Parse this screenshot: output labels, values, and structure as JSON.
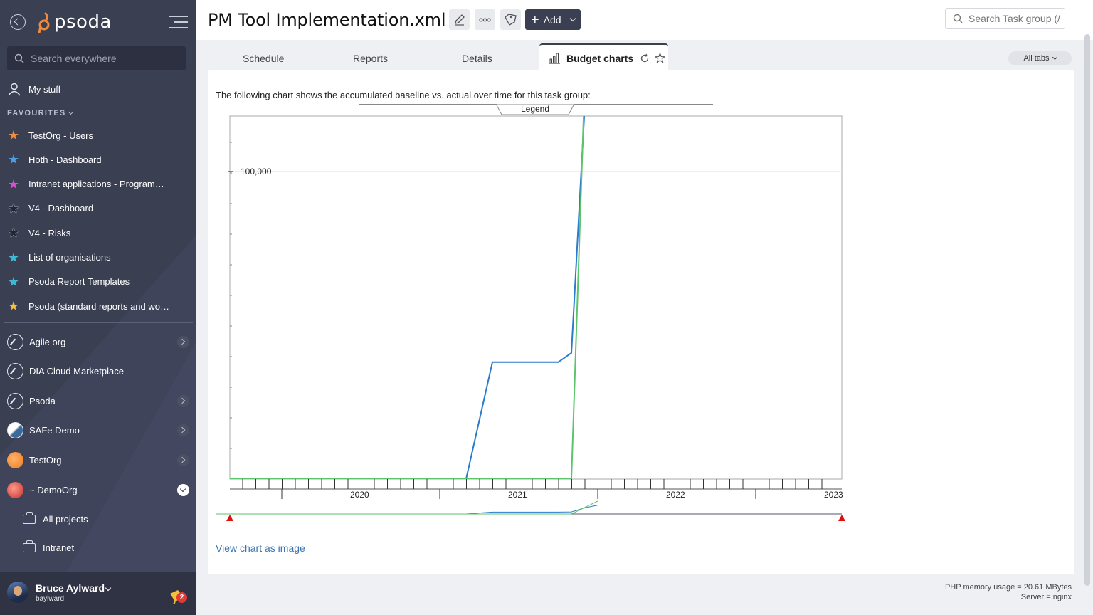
{
  "sidebar": {
    "logo_text": "psoda",
    "search_placeholder": "Search everywhere",
    "my_stuff_label": "My stuff",
    "favourites_header": "FAVOURITES",
    "favourites": [
      {
        "label": "TestOrg - Users",
        "color": "#f28b3a"
      },
      {
        "label": "Hoth - Dashboard",
        "color": "#4a9ee8"
      },
      {
        "label": "Intranet applications - Programme...",
        "color": "#d94fd0"
      },
      {
        "label": "V4 - Dashboard",
        "color": "#222633"
      },
      {
        "label": "V4 - Risks",
        "color": "#222633"
      },
      {
        "label": "List of organisations",
        "color": "#3fb8d6"
      },
      {
        "label": "Psoda Report Templates",
        "color": "#3fb8d6"
      },
      {
        "label": "Psoda (standard reports and work...",
        "color": "#f2c23a"
      }
    ],
    "orgs": [
      {
        "label": "Agile org"
      },
      {
        "label": "DIA Cloud Marketplace"
      },
      {
        "label": "Psoda"
      },
      {
        "label": "SAFe Demo"
      },
      {
        "label": "TestOrg"
      },
      {
        "label": "~ DemoOrg"
      }
    ],
    "sub_items": [
      {
        "label": "All projects"
      },
      {
        "label": "Intranet"
      }
    ],
    "user": {
      "name": "Bruce Aylward",
      "handle": "baylward",
      "notifications": "2"
    }
  },
  "header": {
    "title": "PM Tool Implementation.xml",
    "add_label": "Add",
    "search_placeholder": "Search Task group (/"
  },
  "tabs": {
    "schedule": "Schedule",
    "reports": "Reports",
    "details": "Details",
    "budget_charts": "Budget charts",
    "all_tabs": "All tabs"
  },
  "content": {
    "intro": "The following chart shows the accumulated baseline vs. actual over time for this task group:",
    "legend_label": "Legend",
    "view_image_link": "View chart as image"
  },
  "chart_data": {
    "type": "line",
    "y_tick_labels": [
      "100,000"
    ],
    "x_tick_labels": [
      "2020",
      "2021",
      "2022",
      "2023"
    ],
    "series": [
      {
        "color": "#2a7ccc",
        "x": [
          "2019-08",
          "2021-03",
          "2021-04",
          "2021-05",
          "2021-10",
          "2021-11",
          "2021-12",
          "2022-01"
        ],
        "y": [
          0,
          0,
          19000,
          38000,
          38000,
          41000,
          120000,
          175000
        ]
      },
      {
        "color": "#5cc46a",
        "x": [
          "2019-08",
          "2021-11",
          "2022-01"
        ],
        "y": [
          0,
          0,
          255000
        ]
      }
    ]
  },
  "footer": {
    "memory": "PHP memory usage = 20.61 MBytes",
    "server": "Server = nginx"
  }
}
